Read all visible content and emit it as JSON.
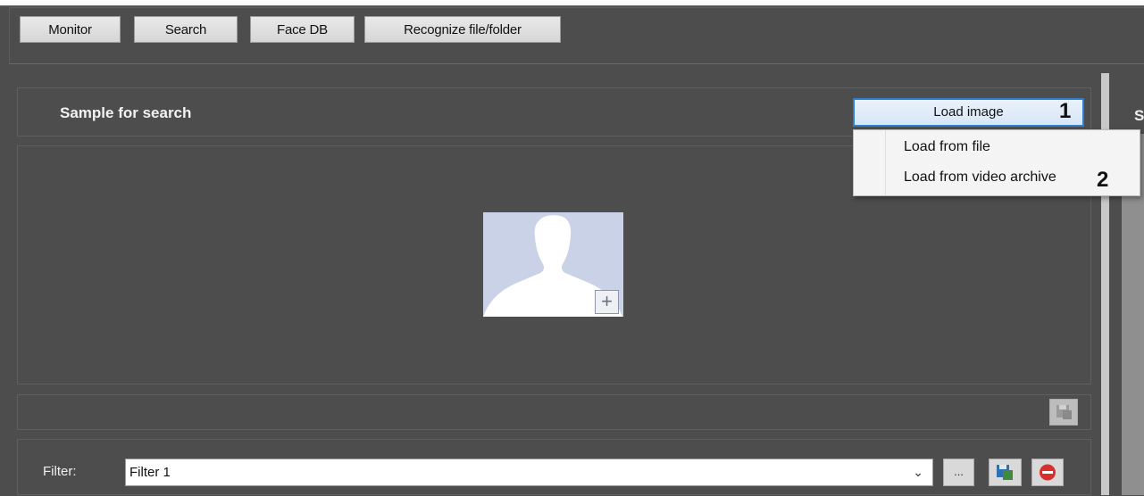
{
  "toolbar": {
    "tabs": [
      {
        "label": "Monitor"
      },
      {
        "label": "Search"
      },
      {
        "label": "Face DB"
      },
      {
        "label": "Recognize file/folder"
      }
    ]
  },
  "sample": {
    "title": "Sample for search",
    "load_button": "Load image",
    "callout_1": "1"
  },
  "load_menu": {
    "items": [
      {
        "label": "Load from file"
      },
      {
        "label": "Load from video archive"
      }
    ],
    "callout_2": "2"
  },
  "filter": {
    "label": "Filter:",
    "value": "Filter 1",
    "browse_button": "..."
  },
  "right_panel": {
    "header_partial": "S"
  },
  "icons": {
    "avatar": "person-placeholder-icon",
    "add": "plus-icon",
    "save": "save-icon",
    "remove": "remove-icon",
    "dropdown": "chevron-down-icon"
  },
  "colors": {
    "background": "#4d4d4d",
    "accent": "#2f7fd0",
    "avatar_bg": "#c9d2e6",
    "remove_red": "#d9302c"
  }
}
